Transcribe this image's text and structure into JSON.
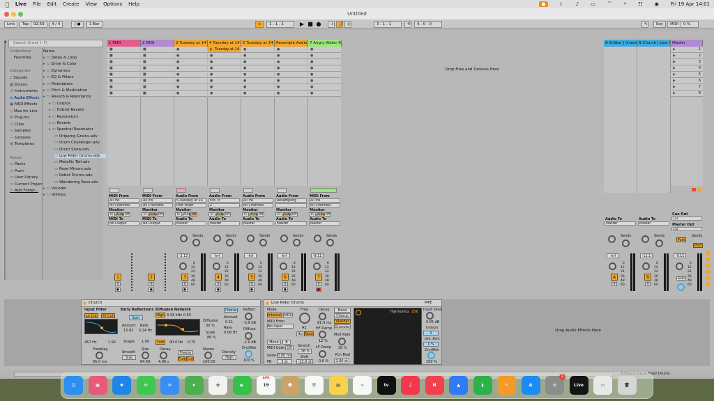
{
  "menubar": {
    "apple": "",
    "app_name": "Live",
    "items": [
      "File",
      "Edit",
      "Create",
      "View",
      "Options",
      "Help"
    ],
    "clock": "Fri 19 Apr  14:01"
  },
  "window": {
    "title": "Untitled"
  },
  "transport": {
    "link": "Link",
    "tap": "Tap",
    "tempo": "92.59",
    "signature": "4 / 4",
    "metro": "○●",
    "quantize": "1 Bar",
    "arr_pos": "1 .  1 .  1",
    "loop_start": "3 .  1 .  1",
    "loop_len": "4 .  0 .  0",
    "key": "Key",
    "midi": "MIDI",
    "cpu": "0 %"
  },
  "browser": {
    "search_placeholder": "Search (Cmd + F)",
    "collections_head": "Collections",
    "favorites": "Favorites",
    "categories_head": "Categories",
    "categories": [
      "Sounds",
      "Drums",
      "Instruments",
      "Audio Effects",
      "MIDI Effects",
      "Max for Live",
      "Plug-Ins",
      "Clips",
      "Samples",
      "Grooves",
      "Templates"
    ],
    "selected_category": "Audio Effects",
    "places_head": "Places",
    "places": [
      "Packs",
      "Push",
      "User Library",
      "Current Project",
      "Add Folder..."
    ],
    "name_head": "Name",
    "tree": [
      "Delay & Loop",
      "Drive & Color",
      "Dynamics",
      "EQ & Filters",
      "Modulators",
      "Pitch & Modulation",
      "Reverb & Resonance",
      "Corpus",
      "Hybrid Reverb",
      "Resonators",
      "Reverb",
      "Spectral Resonator",
      "Dripping Grains.adv",
      "Drum Challenger.adv",
      "Drum Snow.adv",
      "Low Rider Drums.adv",
      "Metallic Tail.adv",
      "Rose Mirrors.adv",
      "Robot Drums.adv",
      "Wandering Reso.adv",
      "Vocoder",
      "Utilities"
    ],
    "selected_tree": "Low Rider Drums.adv"
  },
  "tracks": [
    {
      "name": "1 MIDI",
      "color": "#e35d8f",
      "io_from_label": "MIDI From",
      "from": "All Ins",
      "ch": "All Channels",
      "to_label": "MIDI To",
      "to": "No Output",
      "vol": "",
      "num": "1"
    },
    {
      "name": "2 MIDI",
      "color": "#b38ad1",
      "io_from_label": "MIDI From",
      "from": "All Ins",
      "ch": "All Channels",
      "to_label": "MIDI To",
      "to": "No Output",
      "vol": "",
      "num": "2"
    },
    {
      "name": "3 Tuesday at 14-4",
      "color": "#f0a630",
      "io_from_label": "Audio From",
      "from": "5-Tuesday at 14",
      "ch": "Post Mixer",
      "to_label": "Audio To",
      "to": "Master",
      "vol": "-2.13",
      "num": "3"
    },
    {
      "name": "4 Tuesday at 14-4",
      "color": "#f0a630",
      "io_from_label": "Audio From",
      "from": "Ext. In",
      "ch": "2",
      "to_label": "Audio To",
      "to": "Master",
      "vol": "-Inf",
      "num": "4"
    },
    {
      "name": "5 Tuesday at 14-4",
      "color": "#f0a630",
      "io_from_label": "Audio From",
      "from": "All Ins",
      "ch": "All Channels",
      "to_label": "Audio To",
      "to": "Master",
      "vol": "-Inf",
      "num": "5"
    },
    {
      "name": "Resample Audio",
      "color": "#f0a630",
      "io_from_label": "Audio From",
      "from": "Resampling",
      "ch": "",
      "to_label": "Audio To",
      "to": "Master",
      "vol": "-Inf",
      "num": "6"
    },
    {
      "name": "7 Angry Water Re",
      "color": "#9ce57a",
      "io_from_label": "MIDI From",
      "from": "All Ins",
      "ch": "All Channels",
      "to_label": "Audio To",
      "to": "Master",
      "vol": "-9.11",
      "num": "7"
    }
  ],
  "clip": {
    "track4_clip": "Tuesday at 14-"
  },
  "drop_zone": "Drop Files and Devices Here",
  "returns": [
    {
      "name": "A Shifter | Overdr",
      "to": "Master",
      "vol": "-Inf",
      "letter": "A"
    },
    {
      "name": "B Church | Low Ri",
      "to": "Master",
      "vol": "-11.1",
      "letter": "B"
    }
  ],
  "master": {
    "name": "Master",
    "scenes": [
      "1",
      "2",
      "3",
      "4",
      "5",
      "6",
      "7",
      "8"
    ],
    "cue_out": "Cue Out",
    "cue_val": "1/2",
    "master_out": "Master Out",
    "master_val": "1/2",
    "vol": "-9.11",
    "solo": "Solo"
  },
  "labels": {
    "monitor": "Monitor",
    "in": "In",
    "auto": "Auto",
    "off": "Off",
    "sends": "Sends",
    "post": "Post",
    "audio_to": "Audio To",
    "db_scale": [
      "0",
      "12",
      "24",
      "36",
      "48",
      "60"
    ]
  },
  "church": {
    "title": "Church",
    "input_filter": "Input Filter",
    "lo_cut": "Lo Cut",
    "hi_cut": "Hi Cut",
    "freq1": "467 Hz",
    "bw": "1.92",
    "early": "Early Reflections",
    "spin": "Spin",
    "amount_l": "Amount",
    "rate_l": "Rate",
    "amount": "13.82",
    "rate": "0.24 Hz",
    "shape_l": "Shape",
    "shape": "1.00",
    "diffusion": "Diffusion Network",
    "high": "High",
    "hi_freq": "3.33 kHz",
    "hi_q": "0.55",
    "low": "Low",
    "lo_freq": "90.0 Hz",
    "lo_q": "0.75",
    "chorus": "Chorus",
    "ch_amount_l": "Amount",
    "ch_amount": "0.11",
    "ch_rate_l": "Rate",
    "ch_rate": "0.08 Hz",
    "diff_l": "Diffusion",
    "diff": "30 %",
    "scale_l": "Scale",
    "scale": "86 %",
    "reflect": "Reflect",
    "reflect_v": "-3.9 dB",
    "diffuse": "Diffuse",
    "diffuse_v": "-2.0 dB",
    "drywet": "Dry/Wet",
    "drywet_v": "100 %",
    "predelay_l": "Predelay",
    "predelay": "65.0 ms",
    "smooth_l": "Smooth",
    "smooth": "Size",
    "size_l": "Size",
    "size": "84.59",
    "decay_l": "Decay",
    "decay": "4.98 s",
    "freeze": "Freeze",
    "flat": "Flat",
    "cut": "Cut",
    "stereo_l": "Stereo",
    "stereo": "100.00",
    "density_l": "Density",
    "density": "High"
  },
  "lowrider": {
    "title": "Low Rider Drums",
    "mode": "Mode",
    "internal": "Internal",
    "midi": "MIDI",
    "midi_from": "MIDI From",
    "no_input": "No Input",
    "mono": "Mono",
    "mono_v": "8",
    "midi_gate": "MIDI Gate",
    "midi_gate_v": "Off",
    "glide": "Glide",
    "glide_v": "0.00 ms",
    "pb": "PB",
    "pb_v": "2 st",
    "freq": "Freq",
    "note": "A1",
    "hz": "Hz",
    "note_btn": "Note",
    "stretch": "Stretch",
    "stretch_v": "-76 %",
    "shift": "Shift",
    "shift_v": "-12.0 st",
    "decay": "Decay",
    "decay_v": "81.0 ms",
    "hfdamp": "HF Damp",
    "hfdamp_v": "12 %",
    "lfdamp": "LF Damp",
    "lfdamp_v": "0.0 %",
    "none": "None",
    "chorus": "Chorus",
    "wander": "Wander",
    "granular": "Granular",
    "modrate": "Mod Rate",
    "modrate_v": "30 %",
    "pchmod": "Pch Mod",
    "pchmod_v": "2.00 st",
    "harmonics": "Harmonics",
    "harmonics_v": "256",
    "mpe": "MPE",
    "input_send": "Input Send",
    "input_send_v": "-3.05 dB",
    "unison": "Unison",
    "unison_v": "2",
    "uni_amt": "Uni. Amt",
    "uni_amt_v": "1 %",
    "drywet": "Dry/Wet",
    "drywet_v": "100 %"
  },
  "drop_effects": "Drop Audio Effects Here",
  "status": {
    "right": "B-Church | Low Rider Drums"
  },
  "dock": [
    {
      "name": "Finder",
      "color": "#2d8ff0",
      "glyph": "☺"
    },
    {
      "name": "Launchpad",
      "color": "#e65a7a",
      "glyph": "▦"
    },
    {
      "name": "Safari",
      "color": "#1f86e6",
      "glyph": "✺"
    },
    {
      "name": "Messages",
      "color": "#3fc84f",
      "glyph": "✉"
    },
    {
      "name": "Mail",
      "color": "#3a8ef2",
      "glyph": "✉"
    },
    {
      "name": "Maps",
      "color": "#4caf50",
      "glyph": "➤"
    },
    {
      "name": "Photos",
      "color": "#f2f2f2",
      "glyph": "✿"
    },
    {
      "name": "FaceTime",
      "color": "#35c14a",
      "glyph": "▶"
    },
    {
      "name": "Calendar",
      "color": "#f7f7f7",
      "glyph": "19"
    },
    {
      "name": "Contacts",
      "color": "#c9a46a",
      "glyph": "☻"
    },
    {
      "name": "Reminders",
      "color": "#f7f7f7",
      "glyph": "☰"
    },
    {
      "name": "Notes",
      "color": "#f6d24d",
      "glyph": "▤"
    },
    {
      "name": "Freeform",
      "color": "#f7f7f7",
      "glyph": "~"
    },
    {
      "name": "TV",
      "color": "#111111",
      "glyph": "tv"
    },
    {
      "name": "Music",
      "color": "#f3384e",
      "glyph": "♫"
    },
    {
      "name": "News",
      "color": "#f0414f",
      "glyph": "N"
    },
    {
      "name": "Keynote",
      "color": "#2f7cf6",
      "glyph": "▲"
    },
    {
      "name": "Numbers",
      "color": "#2fb14a",
      "glyph": "▮"
    },
    {
      "name": "Pages",
      "color": "#f49a2b",
      "glyph": "✎"
    },
    {
      "name": "App Store",
      "color": "#1c8cf2",
      "glyph": "A"
    },
    {
      "name": "System Settings",
      "color": "#8c8c8c",
      "glyph": "⚙"
    },
    {
      "name": "Live",
      "color": "#151515",
      "glyph": "Live"
    },
    {
      "name": "Preview",
      "color": "#e8e8e8",
      "glyph": "▭"
    },
    {
      "name": "Trash",
      "color": "#d5d5d5",
      "glyph": "🗑"
    }
  ],
  "dock_calendar_month": "APR",
  "dock_settings_badge": "1"
}
